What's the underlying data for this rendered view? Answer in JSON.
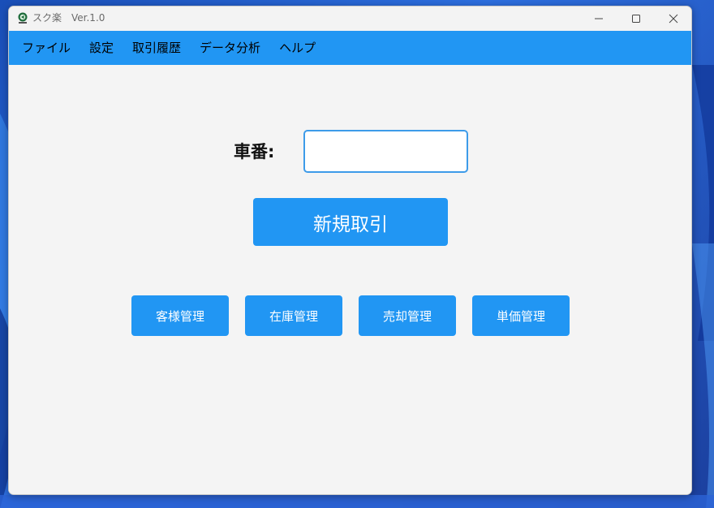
{
  "window": {
    "title": "スク楽　Ver.1.0"
  },
  "menu": {
    "items": [
      {
        "label": "ファイル"
      },
      {
        "label": "設定"
      },
      {
        "label": "取引履歴"
      },
      {
        "label": "データ分析"
      },
      {
        "label": "ヘルプ"
      }
    ]
  },
  "form": {
    "car_number_label": "車番:",
    "car_number_value": "",
    "new_transaction_label": "新規取引"
  },
  "actions": {
    "items": [
      {
        "label": "客様管理"
      },
      {
        "label": "在庫管理"
      },
      {
        "label": "売却管理"
      },
      {
        "label": "単価管理"
      }
    ]
  },
  "colors": {
    "accent": "#2196f3",
    "input_border": "#3d9be9",
    "background": "#f4f4f4"
  }
}
